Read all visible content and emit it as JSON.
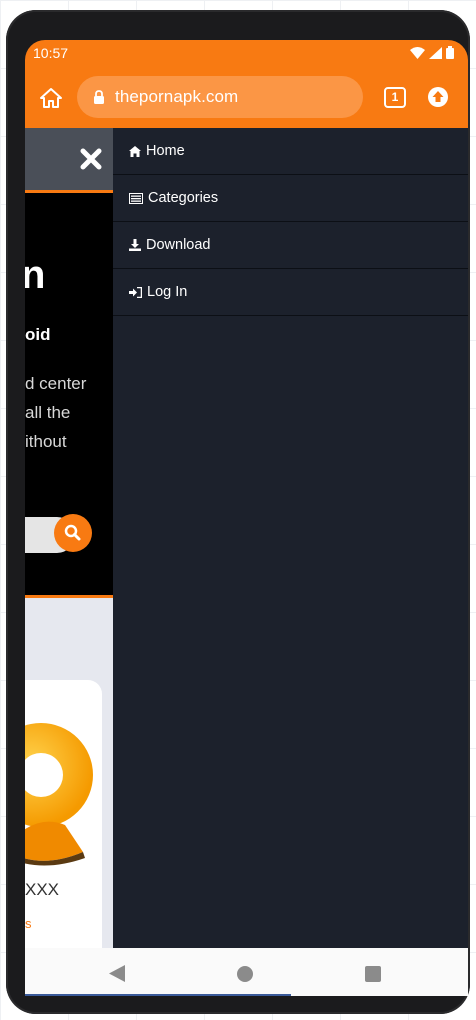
{
  "status_bar": {
    "time": "10:57"
  },
  "browser": {
    "url": "thepornapk.com",
    "tab_count": "1"
  },
  "page_peek": {
    "hero_title_fragment": "n",
    "hero_subtitle_fragment": "oid",
    "hero_description_fragment": "d center\nall the\nithout",
    "card_title_fragment": "XXX",
    "card_link_fragment": "s"
  },
  "drawer_menu": {
    "items": [
      {
        "label": "Home",
        "icon": "home-icon"
      },
      {
        "label": "Categories",
        "icon": "list-icon"
      },
      {
        "label": "Download",
        "icon": "download-icon"
      },
      {
        "label": "Log In",
        "icon": "sign-in-icon"
      }
    ]
  },
  "colors": {
    "accent": "#f87a12",
    "drawer_bg": "#1c212c"
  }
}
